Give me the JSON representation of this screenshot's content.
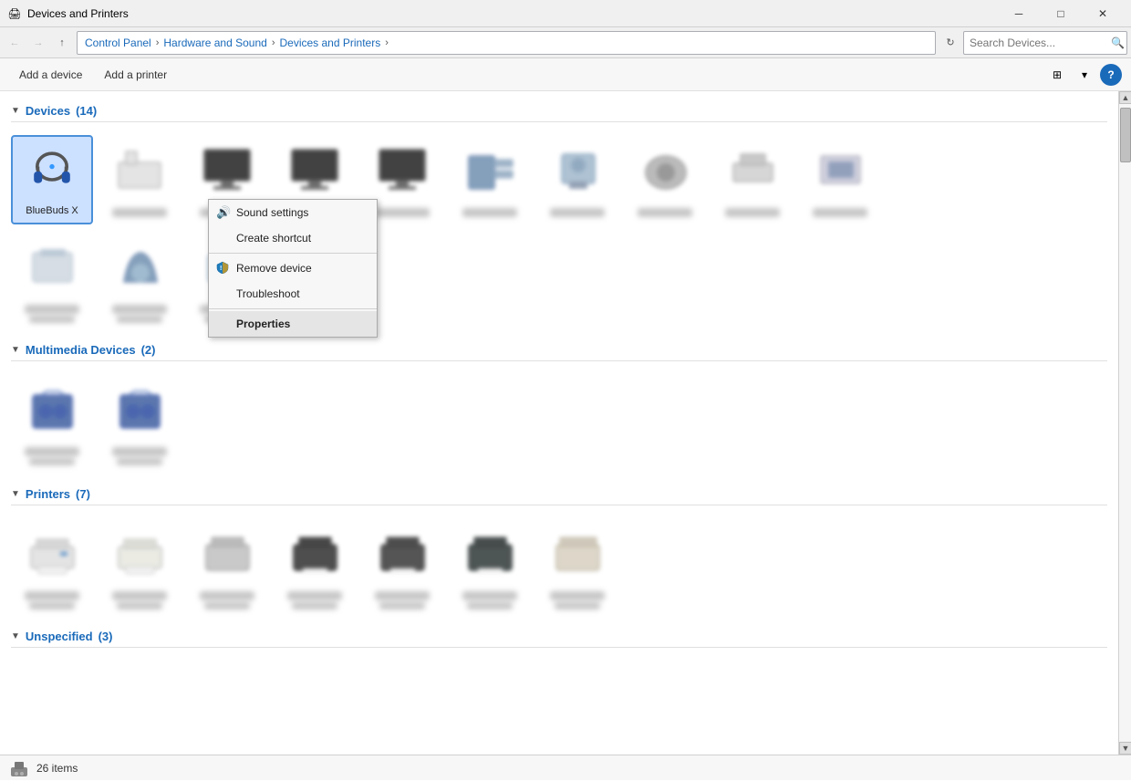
{
  "window": {
    "title": "Devices and Printers",
    "icon": "🖨",
    "min_label": "─",
    "max_label": "□",
    "close_label": "✕"
  },
  "addressbar": {
    "back_disabled": true,
    "forward_disabled": true,
    "up_label": "↑",
    "breadcrumbs": [
      {
        "label": "Control Panel"
      },
      {
        "label": "Hardware and Sound"
      },
      {
        "label": "Devices and Printers"
      }
    ],
    "search_placeholder": "Search Devices...",
    "refresh_label": "⟳"
  },
  "toolbar": {
    "add_device": "Add a device",
    "add_printer": "Add a printer",
    "view_label": "⊞",
    "dropdown_label": "▾",
    "help_label": "?"
  },
  "sections": {
    "devices": {
      "label": "Devices",
      "count": "(14)"
    },
    "multimedia": {
      "label": "Multimedia Devices",
      "count": "(2)"
    },
    "printers": {
      "label": "Printers",
      "count": "(7)"
    },
    "unspecified": {
      "label": "Unspecified",
      "count": "(3)"
    }
  },
  "selected_device": {
    "name": "BlueBuds X",
    "selected": true
  },
  "context_menu": {
    "items": [
      {
        "id": "sound-settings",
        "label": "Sound settings",
        "icon": "🔊",
        "bold": false
      },
      {
        "id": "create-shortcut",
        "label": "Create shortcut",
        "icon": "",
        "bold": false
      },
      {
        "id": "remove-device",
        "label": "Remove device",
        "icon": "shield",
        "bold": false
      },
      {
        "id": "troubleshoot",
        "label": "Troubleshoot",
        "icon": "",
        "bold": false
      },
      {
        "id": "properties",
        "label": "Properties",
        "icon": "",
        "bold": true
      }
    ]
  },
  "statusbar": {
    "count": "26 items"
  }
}
